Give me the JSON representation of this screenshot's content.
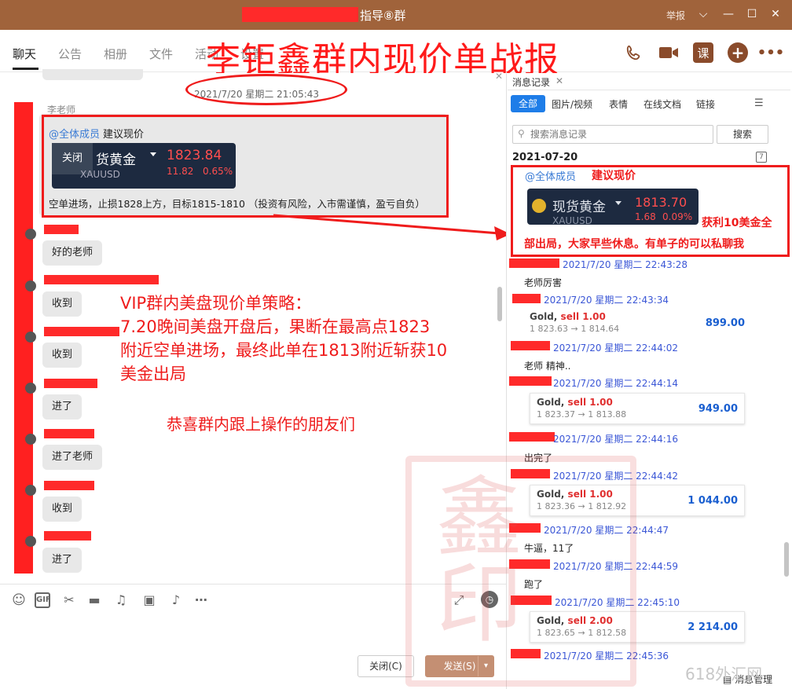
{
  "window": {
    "title": "指导⑧群",
    "report_label": "举报",
    "controls": [
      "⌵",
      "—",
      "☐",
      "✕"
    ]
  },
  "nav": {
    "tabs": [
      "聊天",
      "公告",
      "相册",
      "文件",
      "活动",
      "设置"
    ],
    "active": "聊天"
  },
  "overlay_title": "李钜鑫群内现价单战报",
  "chat": {
    "timestamp": "2021/7/20 星期二 21:05:43",
    "sender": "李老师",
    "mention": "@全体成员",
    "mention_text": "建议现价",
    "quote": {
      "close_label": "关闭",
      "name": "货黄金",
      "symbol": "XAUUSD",
      "price": "1823.84",
      "change": "11.82",
      "change_pct": "0.65%"
    },
    "message": "空单进场，止损1828上方，目标1815-1810 （投资有风险，入市需谨慎，盈亏自负）",
    "replies": [
      "好的老师",
      "收到",
      "收到",
      "进了",
      "进了老师",
      "收到",
      "进了"
    ]
  },
  "annotations": {
    "strategy_lines": [
      "VIP群内美盘现价单策略：",
      "7.20晚间美盘开盘后，果断在最高点1823",
      "附近空单进场，最终此单在1813附近斩获10",
      "美金出局"
    ],
    "congrats": "恭喜群内跟上操作的朋友们"
  },
  "toolbar": {
    "icons": [
      "emoji-icon",
      "gif-icon",
      "scissors-icon",
      "folder-icon",
      "music-icon",
      "image-icon",
      "bell-icon",
      "more-icon"
    ],
    "gif_label": "GIF",
    "close_button": "关闭(C)",
    "send_button": "发送(S)"
  },
  "history": {
    "panel_title": "消息记录",
    "filters": [
      "全部",
      "图片/视频",
      "表情",
      "在线文档",
      "链接"
    ],
    "active_filter": "全部",
    "search_placeholder": "搜索消息记录",
    "search_button": "搜索",
    "date": "2021-07-20",
    "mention": "@全体成员",
    "mention_text": "建议现价",
    "quote": {
      "name": "现货黄金",
      "symbol": "XAUUSD",
      "price": "1813.70",
      "change": "1.68",
      "change_pct": "0.09%"
    },
    "profit_note_1": "获利10美金全",
    "profit_note_2": "部出局，大家早些休息。有单子的可以私聊我",
    "entries": [
      {
        "time": "2021/7/20 星期二 22:43:28",
        "text": "老师厉害"
      },
      {
        "time": "2021/7/20 星期二 22:43:34",
        "trade": {
          "title": "Gold,",
          "side": "sell 1.00",
          "route": "1 823.63 → 1 814.64",
          "amount": "899.00"
        }
      },
      {
        "time": "2021/7/20 星期二 22:44:02",
        "text": "老师 精神.."
      },
      {
        "time": "2021/7/20 星期二 22:44:14",
        "trade": {
          "title": "Gold,",
          "side": "sell 1.00",
          "route": "1 823.37 → 1 813.88",
          "amount": "949.00"
        }
      },
      {
        "time": "2021/7/20 星期二 22:44:16",
        "text": "出完了"
      },
      {
        "time": "2021/7/20 星期二 22:44:42",
        "trade": {
          "title": "Gold,",
          "side": "sell 1.00",
          "route": "1 823.36 → 1 812.92",
          "amount": "1 044.00"
        }
      },
      {
        "time": "2021/7/20 星期二 22:44:47",
        "text": "牛逼，11了"
      },
      {
        "time": "2021/7/20 星期二 22:44:59",
        "text": "跑了"
      },
      {
        "time": "2021/7/20 星期二 22:45:10",
        "trade": {
          "title": "Gold,",
          "side": "sell 2.00",
          "route": "1 823.65 → 1 812.58",
          "amount": "2 214.00"
        }
      },
      {
        "time": "2021/7/20 星期二 22:45:36",
        "text": ""
      }
    ],
    "manage_label": "消息管理"
  },
  "watermark": {
    "seal_text": "鑫印",
    "site": "618外汇网"
  }
}
